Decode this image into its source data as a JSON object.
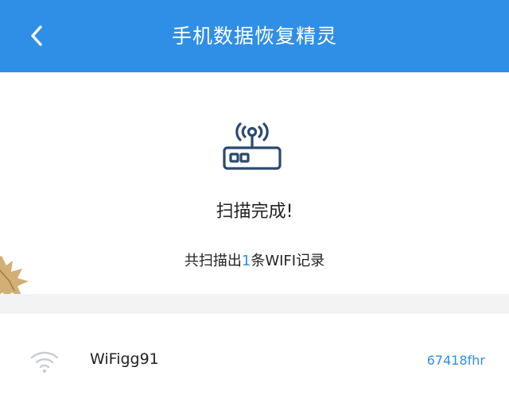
{
  "header": {
    "title": "手机数据恢复精灵",
    "back_icon": "chevron-left-icon",
    "background": "#2f8fe6"
  },
  "result": {
    "icon": "wifi-router-icon",
    "status": "扫描完成!",
    "summary_prefix": "共扫描出",
    "summary_count": "1",
    "summary_suffix": "条WIFI记录"
  },
  "wifi_list": [
    {
      "icon": "wifi-signal-icon",
      "name": "WiFigg91",
      "password": "67418fhr"
    }
  ],
  "colors": {
    "accent": "#2f8fe6",
    "band": "#f2f3f5"
  }
}
